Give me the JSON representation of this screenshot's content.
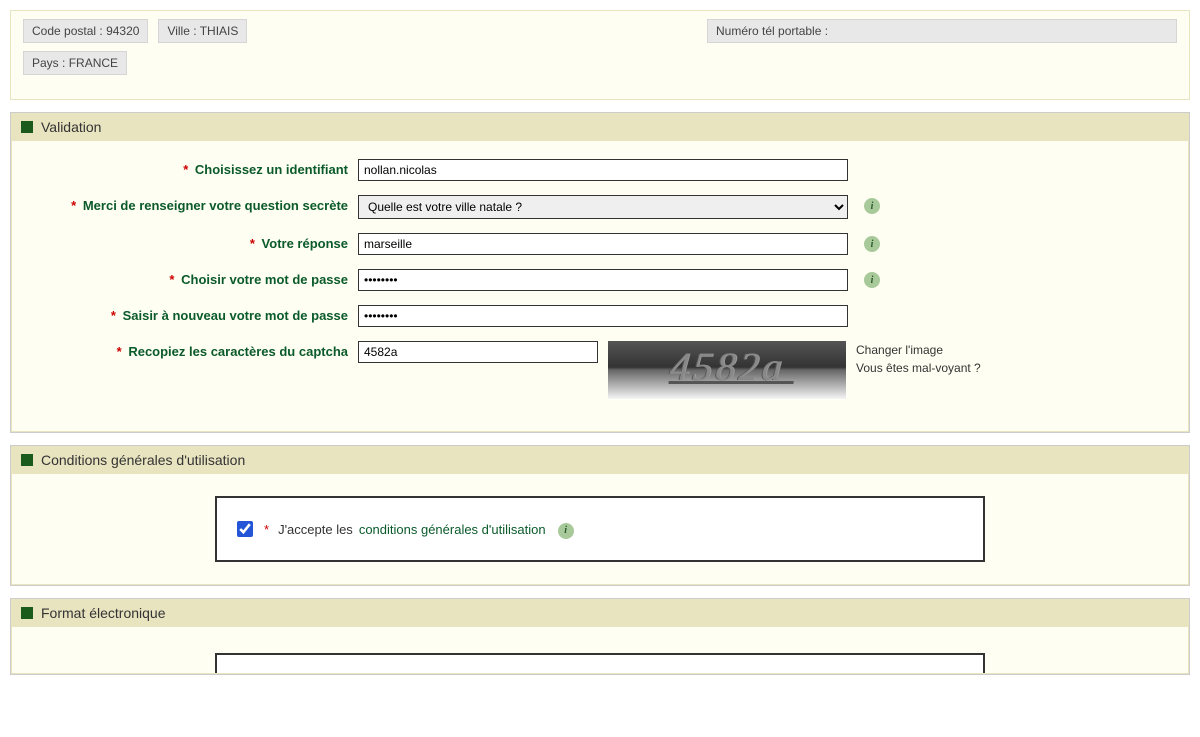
{
  "address": {
    "postal_label": "Code postal :",
    "postal_value": "94320",
    "city_label": "Ville :",
    "city_value": "THIAIS",
    "mobile_label": "Numéro tél portable :",
    "mobile_value": "",
    "country_label": "Pays :",
    "country_value": "FRANCE"
  },
  "validation": {
    "title": "Validation",
    "identifier_label": "Choisissez un identifiant",
    "identifier_value": "nollan.nicolas",
    "question_label": "Merci de renseigner votre question secrète",
    "question_value": "Quelle est votre ville natale ?",
    "answer_label": "Votre réponse",
    "answer_value": "marseille",
    "password_label": "Choisir votre mot de passe",
    "password_value": "••••••••",
    "password2_label": "Saisir à nouveau votre mot de passe",
    "password2_value": "••••••••",
    "captcha_label": "Recopiez les caractères du captcha",
    "captcha_value": "4582a",
    "captcha_display": "4582a",
    "change_image": "Changer l'image",
    "visually_impaired": "Vous êtes mal-voyant ?"
  },
  "cgu": {
    "title": "Conditions générales d'utilisation",
    "accept_prefix": "J'accepte les",
    "link_text": "conditions générales d'utilisation"
  },
  "format": {
    "title": "Format électronique"
  }
}
